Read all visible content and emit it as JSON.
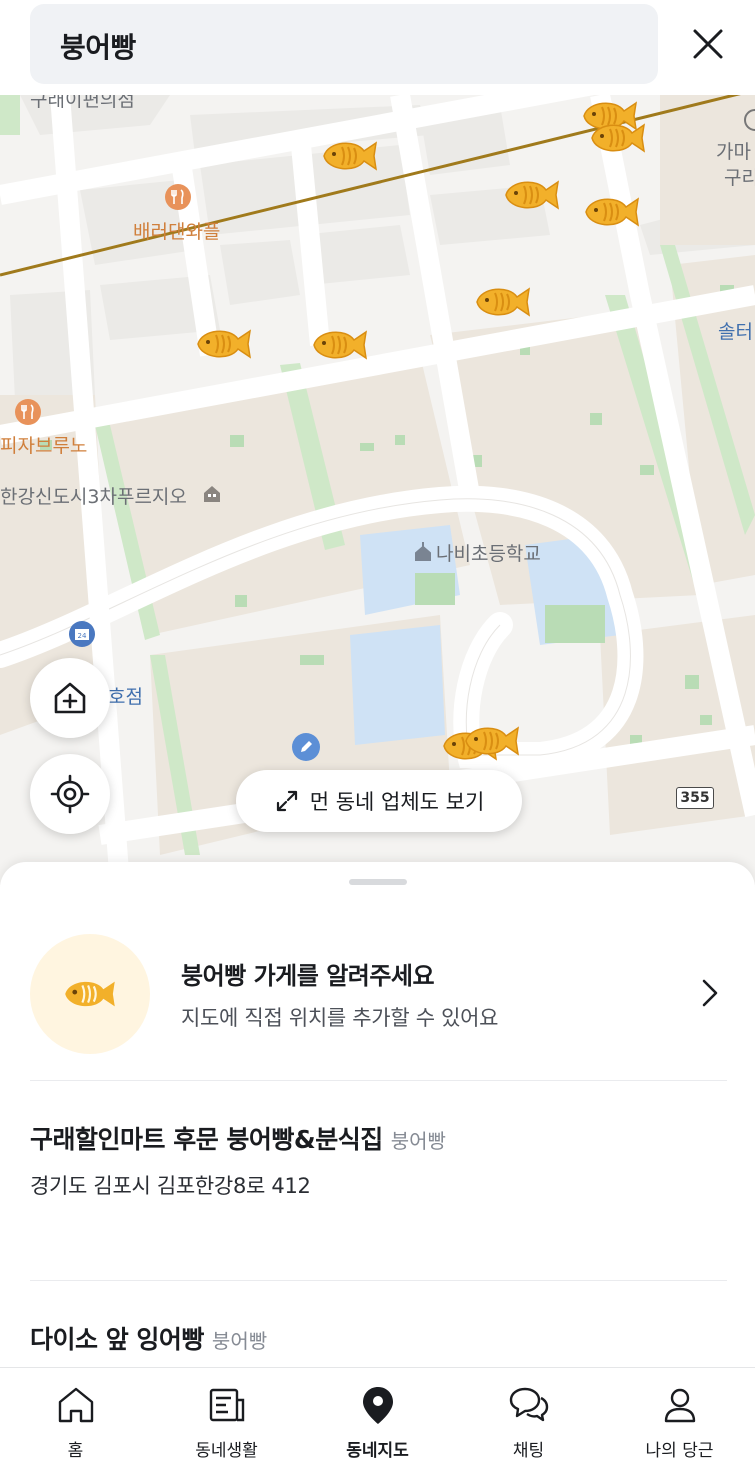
{
  "search": {
    "query": "붕어빵"
  },
  "map": {
    "labels": {
      "waffle": "배러댄와플",
      "pizza": "피자브루노",
      "apt": "한강신도시3차푸르지오",
      "school": "나비초등학교",
      "gamart_1": "가마",
      "gamart_2": "구리",
      "solter": "솔터",
      "mart_store": "호점",
      "top_cut": "구래이편의점",
      "road_number": "355"
    },
    "expand_button": "먼 동네 업체도 보기"
  },
  "sheet": {
    "promo_title": "붕어빵 가게를 알려주세요",
    "promo_sub": "지도에 직접 위치를 추가할 수 있어요",
    "stores": [
      {
        "name": "구래할인마트 후문 붕어빵&분식집",
        "category": "붕어빵",
        "address": "경기도 김포시 김포한강8로 412"
      },
      {
        "name": "다이소 앞 잉어빵",
        "category": "붕어빵"
      }
    ]
  },
  "tabs": [
    {
      "label": "홈",
      "icon": "home-icon"
    },
    {
      "label": "동네생활",
      "icon": "news-icon"
    },
    {
      "label": "동네지도",
      "icon": "map-pin-icon"
    },
    {
      "label": "채팅",
      "icon": "chat-icon"
    },
    {
      "label": "나의 당근",
      "icon": "user-icon"
    }
  ],
  "colors": {
    "accent_orange": "#f5a623",
    "fish_fill": "#f2b02a",
    "text_primary": "#1a1c20",
    "text_secondary": "#868b94"
  }
}
